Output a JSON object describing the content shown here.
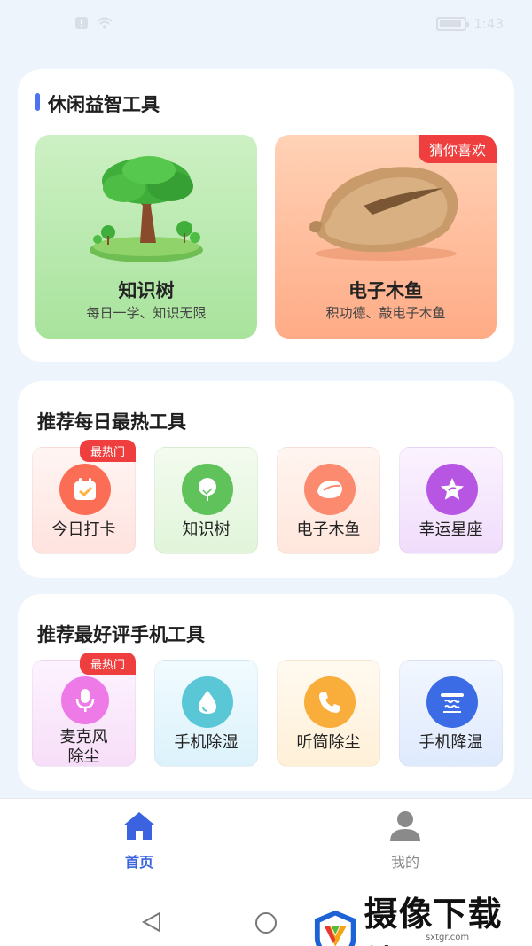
{
  "status_bar": {
    "time": "1:43"
  },
  "section1": {
    "title": "休闲益智工具",
    "tiles": [
      {
        "name": "知识树",
        "desc": "每日一学、知识无限"
      },
      {
        "name": "电子木鱼",
        "desc": "积功德、敲电子木鱼",
        "badge": "猜你喜欢"
      }
    ]
  },
  "section2": {
    "title": "推荐每日最热工具",
    "hot_badge": "最热门",
    "tools": [
      {
        "label": "今日打卡",
        "icon": "calendar-check-icon"
      },
      {
        "label": "知识树",
        "icon": "tree-icon"
      },
      {
        "label": "电子木鱼",
        "icon": "wooden-fish-icon"
      },
      {
        "label": "幸运星座",
        "icon": "star-icon"
      }
    ]
  },
  "section3": {
    "title": "推荐最好评手机工具",
    "hot_badge": "最热门",
    "tools": [
      {
        "label_line1": "麦克风",
        "label_line2": "除尘",
        "icon": "microphone-icon"
      },
      {
        "label": "手机除湿",
        "icon": "droplet-icon"
      },
      {
        "label": "听筒除尘",
        "icon": "phone-icon"
      },
      {
        "label": "手机降温",
        "icon": "cooling-icon"
      }
    ]
  },
  "bottom_nav": {
    "home": "首页",
    "mine": "我的"
  },
  "watermark": {
    "text": "摄像下载站",
    "url": "sxtgr.com"
  }
}
